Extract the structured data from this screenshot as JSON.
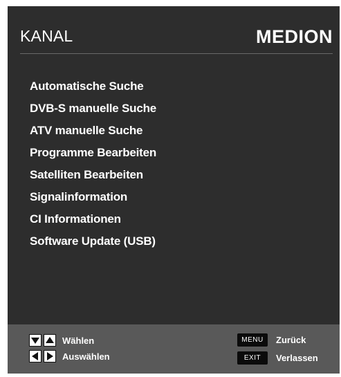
{
  "header": {
    "title": "KANAL",
    "brand": "MEDION"
  },
  "menu": {
    "items": [
      {
        "label": "Automatische Suche"
      },
      {
        "label": "DVB-S manuelle Suche"
      },
      {
        "label": "ATV manuelle Suche"
      },
      {
        "label": "Programme Bearbeiten"
      },
      {
        "label": "Satelliten Bearbeiten"
      },
      {
        "label": "Signalinformation"
      },
      {
        "label": "CI Informationen"
      },
      {
        "label": "Software Update (USB)"
      }
    ]
  },
  "footer": {
    "select_label": "Wählen",
    "choose_label": "Auswählen",
    "menu_key": "MENU",
    "back_label": "Zurück",
    "exit_key": "EXIT",
    "exit_label": "Verlassen"
  },
  "icons": {
    "down": "arrow-down-icon",
    "up": "arrow-up-icon",
    "left": "arrow-left-icon",
    "right": "arrow-right-icon"
  },
  "colors": {
    "panel": "#2d2d2d",
    "footer": "#595959",
    "text": "#ffffff",
    "keycap": "#0b0b0b"
  }
}
